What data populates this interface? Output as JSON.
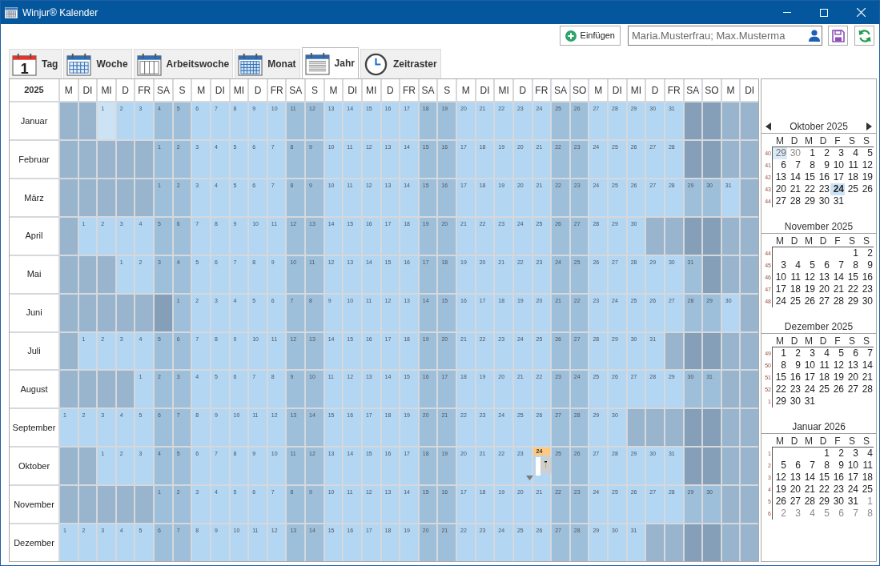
{
  "window": {
    "title": "Winjur® Kalender"
  },
  "toolbar": {
    "insert_button": "Einfügen",
    "people_field": {
      "value": "Maria.Musterfrau; Max.Musterma"
    }
  },
  "tabs": [
    {
      "label": "Tag",
      "kind": "day",
      "icon_text": "1",
      "selected": false
    },
    {
      "label": "Woche",
      "kind": "week",
      "selected": false
    },
    {
      "label": "Arbeitswoche",
      "kind": "workweek",
      "selected": false
    },
    {
      "label": "Monat",
      "kind": "month",
      "selected": false
    },
    {
      "label": "Jahr",
      "kind": "year",
      "selected": true
    },
    {
      "label": "Zeitraster",
      "kind": "timegrid",
      "selected": false
    }
  ],
  "year_grid": {
    "year": "2025",
    "columns": [
      {
        "label": "M",
        "weekend": false
      },
      {
        "label": "DI",
        "weekend": false
      },
      {
        "label": "MI",
        "weekend": false
      },
      {
        "label": "D",
        "weekend": false
      },
      {
        "label": "FR",
        "weekend": false
      },
      {
        "label": "SA",
        "weekend": true
      },
      {
        "label": "S",
        "weekend": true
      },
      {
        "label": "M",
        "weekend": false
      },
      {
        "label": "DI",
        "weekend": false
      },
      {
        "label": "MI",
        "weekend": false
      },
      {
        "label": "D",
        "weekend": false
      },
      {
        "label": "FR",
        "weekend": false
      },
      {
        "label": "SA",
        "weekend": true
      },
      {
        "label": "S",
        "weekend": true
      },
      {
        "label": "M",
        "weekend": false
      },
      {
        "label": "DI",
        "weekend": false
      },
      {
        "label": "MI",
        "weekend": false
      },
      {
        "label": "D",
        "weekend": false
      },
      {
        "label": "FR",
        "weekend": false
      },
      {
        "label": "SA",
        "weekend": true
      },
      {
        "label": "S",
        "weekend": true
      },
      {
        "label": "M",
        "weekend": false
      },
      {
        "label": "DI",
        "weekend": false
      },
      {
        "label": "MI",
        "weekend": false
      },
      {
        "label": "D",
        "weekend": false
      },
      {
        "label": "FR",
        "weekend": false
      },
      {
        "label": "SA",
        "weekend": true
      },
      {
        "label": "SO",
        "weekend": true
      },
      {
        "label": "M",
        "weekend": false
      },
      {
        "label": "DI",
        "weekend": false
      },
      {
        "label": "MI",
        "weekend": false
      },
      {
        "label": "D",
        "weekend": false
      },
      {
        "label": "FR",
        "weekend": false
      },
      {
        "label": "SA",
        "weekend": true
      },
      {
        "label": "SO",
        "weekend": true
      },
      {
        "label": "M",
        "weekend": false
      },
      {
        "label": "DI",
        "weekend": false
      }
    ],
    "months": [
      {
        "name": "Januar",
        "cells": [
          {
            "kind": "blank"
          },
          {
            "kind": "blank"
          },
          {
            "kind": "focus",
            "label": "1"
          },
          "2",
          "3",
          "4",
          "5",
          "6",
          "7",
          "8",
          "9",
          "10",
          "11",
          "12",
          "13",
          "14",
          "15",
          "16",
          "17",
          "18",
          "19",
          "20",
          "21",
          "22",
          "23",
          "24",
          "25",
          "26",
          "27",
          "28",
          "29",
          "30",
          "31",
          {
            "kind": "blank"
          },
          {
            "kind": "blank"
          },
          {
            "kind": "blank"
          },
          {
            "kind": "blank"
          }
        ]
      },
      {
        "name": "Februar",
        "cells": [
          {
            "kind": "blank"
          },
          {
            "kind": "blank"
          },
          {
            "kind": "blank"
          },
          {
            "kind": "blank"
          },
          {
            "kind": "blank"
          },
          "1",
          "2",
          "3",
          "4",
          "5",
          "6",
          "7",
          "8",
          "9",
          "10",
          "11",
          "12",
          "13",
          "14",
          "15",
          "16",
          "17",
          "18",
          "19",
          "20",
          "21",
          "22",
          "23",
          "24",
          "25",
          "26",
          "27",
          "28",
          {
            "kind": "blank"
          },
          {
            "kind": "blank"
          },
          {
            "kind": "blank"
          },
          {
            "kind": "blank"
          }
        ]
      },
      {
        "name": "März",
        "cells": [
          {
            "kind": "blank"
          },
          {
            "kind": "blank"
          },
          {
            "kind": "blank"
          },
          {
            "kind": "blank"
          },
          {
            "kind": "blank"
          },
          "1",
          "2",
          "3",
          "4",
          "5",
          "6",
          "7",
          "8",
          "9",
          "10",
          "11",
          "12",
          "13",
          "14",
          "15",
          "16",
          "17",
          "18",
          "19",
          "20",
          "21",
          "22",
          "23",
          "24",
          "25",
          "26",
          "27",
          "28",
          "29",
          "30",
          "31",
          {
            "kind": "blank"
          }
        ]
      },
      {
        "name": "April",
        "cells": [
          {
            "kind": "blank"
          },
          "1",
          "2",
          "3",
          "4",
          "5",
          "6",
          "7",
          "8",
          "9",
          "10",
          "11",
          "12",
          "13",
          "14",
          "15",
          "16",
          "17",
          "18",
          "19",
          "20",
          "21",
          "22",
          "23",
          "24",
          "25",
          "26",
          "27",
          "28",
          "29",
          "30",
          {
            "kind": "blank"
          },
          {
            "kind": "blank"
          },
          {
            "kind": "blank"
          },
          {
            "kind": "blank"
          },
          {
            "kind": "blank"
          },
          {
            "kind": "blank"
          }
        ]
      },
      {
        "name": "Mai",
        "cells": [
          {
            "kind": "blank"
          },
          {
            "kind": "blank"
          },
          {
            "kind": "blank"
          },
          "1",
          "2",
          "3",
          "4",
          "5",
          "6",
          "7",
          "8",
          "9",
          "10",
          "11",
          "12",
          "13",
          "14",
          "15",
          "16",
          "17",
          "18",
          "19",
          "20",
          "21",
          "22",
          "23",
          "24",
          "25",
          "26",
          "27",
          "28",
          "29",
          "30",
          "31",
          {
            "kind": "blank"
          },
          {
            "kind": "blank"
          },
          {
            "kind": "blank"
          }
        ]
      },
      {
        "name": "Juni",
        "cells": [
          {
            "kind": "blank"
          },
          {
            "kind": "blank"
          },
          {
            "kind": "blank"
          },
          {
            "kind": "blank"
          },
          {
            "kind": "blank"
          },
          {
            "kind": "blank"
          },
          "1",
          "2",
          "3",
          "4",
          "5",
          "6",
          "7",
          "8",
          "9",
          "10",
          "11",
          "12",
          "13",
          "14",
          "15",
          "16",
          "17",
          "18",
          "19",
          "20",
          "21",
          "22",
          "23",
          "24",
          "25",
          "26",
          "27",
          "28",
          "29",
          "30",
          {
            "kind": "blank"
          }
        ]
      },
      {
        "name": "Juli",
        "cells": [
          {
            "kind": "blank"
          },
          "1",
          "2",
          "3",
          "4",
          "5",
          "6",
          "7",
          "8",
          "9",
          "10",
          "11",
          "12",
          "13",
          "14",
          "15",
          "16",
          "17",
          "18",
          "19",
          "20",
          "21",
          "22",
          "23",
          "24",
          "25",
          "26",
          "27",
          "28",
          "29",
          "30",
          "31",
          {
            "kind": "blank"
          },
          {
            "kind": "blank"
          },
          {
            "kind": "blank"
          },
          {
            "kind": "blank"
          },
          {
            "kind": "blank"
          }
        ]
      },
      {
        "name": "August",
        "cells": [
          {
            "kind": "blank"
          },
          {
            "kind": "blank"
          },
          {
            "kind": "blank"
          },
          {
            "kind": "blank"
          },
          "1",
          "2",
          "3",
          "4",
          "5",
          "6",
          "7",
          "8",
          "9",
          "10",
          "11",
          "12",
          "13",
          "14",
          "15",
          "16",
          "17",
          "18",
          "19",
          "20",
          "21",
          "22",
          "23",
          "24",
          "25",
          "26",
          "27",
          "28",
          "29",
          "30",
          "31",
          {
            "kind": "blank"
          },
          {
            "kind": "blank"
          }
        ]
      },
      {
        "name": "September",
        "cells": [
          "1",
          "2",
          "3",
          "4",
          "5",
          "6",
          "7",
          "8",
          "9",
          "10",
          "11",
          "12",
          "13",
          "14",
          "15",
          "16",
          "17",
          "18",
          "19",
          "20",
          "21",
          "22",
          "23",
          "24",
          "25",
          "26",
          "27",
          "28",
          "29",
          "30",
          {
            "kind": "blank"
          },
          {
            "kind": "blank"
          },
          {
            "kind": "blank"
          },
          {
            "kind": "blank"
          },
          {
            "kind": "blank"
          },
          {
            "kind": "blank"
          },
          {
            "kind": "blank"
          }
        ]
      },
      {
        "name": "Oktober",
        "cells": [
          {
            "kind": "blank"
          },
          {
            "kind": "blank"
          },
          "1",
          "2",
          "3",
          "4",
          "5",
          "6",
          "7",
          "8",
          "9",
          "10",
          "11",
          "12",
          "13",
          "14",
          "15",
          "16",
          "17",
          "18",
          "19",
          "20",
          "21",
          "22",
          "23",
          {
            "kind": "today",
            "label": "24",
            "appointment": true
          },
          "25",
          "26",
          "27",
          "28",
          "29",
          "30",
          "31",
          {
            "kind": "blank"
          },
          {
            "kind": "blank"
          },
          {
            "kind": "blank"
          },
          {
            "kind": "blank"
          }
        ]
      },
      {
        "name": "November",
        "cells": [
          {
            "kind": "blank"
          },
          {
            "kind": "blank"
          },
          {
            "kind": "blank"
          },
          {
            "kind": "blank"
          },
          {
            "kind": "blank"
          },
          "1",
          "2",
          "3",
          "4",
          "5",
          "6",
          "7",
          "8",
          "9",
          "10",
          "11",
          "12",
          "13",
          "14",
          "15",
          "16",
          "17",
          "18",
          "19",
          "20",
          "21",
          "22",
          "23",
          "24",
          "25",
          "26",
          "27",
          "28",
          "29",
          "30",
          {
            "kind": "blank"
          },
          {
            "kind": "blank"
          }
        ]
      },
      {
        "name": "Dezember",
        "cells": [
          "1",
          "2",
          "3",
          "4",
          "5",
          "6",
          "7",
          "8",
          "9",
          "10",
          "11",
          "12",
          "13",
          "14",
          "15",
          "16",
          "17",
          "18",
          "19",
          "20",
          "21",
          "22",
          "23",
          "24",
          "25",
          "26",
          "27",
          "28",
          "29",
          "30",
          "31",
          {
            "kind": "blank"
          },
          {
            "kind": "blank"
          },
          {
            "kind": "blank"
          },
          {
            "kind": "blank"
          },
          {
            "kind": "blank"
          },
          {
            "kind": "blank"
          }
        ]
      }
    ]
  },
  "mini_calendars": [
    {
      "title": "Oktober 2025",
      "navigation": true,
      "weekdays": [
        "M",
        "D",
        "M",
        "D",
        "F",
        "S",
        "S"
      ],
      "weeks": [
        {
          "number": "40",
          "days": [
            {
              "kind": "highlighted",
              "label": "29"
            },
            {
              "kind": "adjacent",
              "label": "30"
            },
            "1",
            "2",
            "3",
            "4",
            "5"
          ]
        },
        {
          "number": "41",
          "days": [
            "6",
            "7",
            "8",
            "9",
            "10",
            "11",
            "12"
          ]
        },
        {
          "number": "42",
          "days": [
            "13",
            "14",
            "15",
            "16",
            "17",
            "18",
            "19"
          ]
        },
        {
          "number": "43",
          "days": [
            "20",
            "21",
            "22",
            "23",
            {
              "kind": "selected",
              "label": "24"
            },
            "25",
            "26"
          ]
        },
        {
          "number": "44",
          "days": [
            "27",
            "28",
            "29",
            "30",
            "31"
          ]
        }
      ]
    },
    {
      "title": "November 2025",
      "navigation": false,
      "weekdays": [
        "M",
        "D",
        "M",
        "D",
        "F",
        "S",
        "S"
      ],
      "weeks": [
        {
          "number": "44",
          "days": [
            {
              "kind": "blank"
            },
            {
              "kind": "blank"
            },
            {
              "kind": "blank"
            },
            {
              "kind": "blank"
            },
            {
              "kind": "blank"
            },
            "1",
            "2"
          ]
        },
        {
          "number": "45",
          "days": [
            "3",
            "4",
            "5",
            "6",
            "7",
            "8",
            "9"
          ]
        },
        {
          "number": "46",
          "days": [
            "10",
            "11",
            "12",
            "13",
            "14",
            "15",
            "16"
          ]
        },
        {
          "number": "47",
          "days": [
            "17",
            "18",
            "19",
            "20",
            "21",
            "22",
            "23"
          ]
        },
        {
          "number": "48",
          "days": [
            "24",
            "25",
            "26",
            "27",
            "28",
            "29",
            "30"
          ]
        }
      ]
    },
    {
      "title": "Dezember 2025",
      "navigation": false,
      "weekdays": [
        "M",
        "D",
        "M",
        "D",
        "F",
        "S",
        "S"
      ],
      "weeks": [
        {
          "number": "49",
          "days": [
            "1",
            "2",
            "3",
            "4",
            "5",
            "6",
            "7"
          ]
        },
        {
          "number": "50",
          "days": [
            "8",
            "9",
            "10",
            "11",
            "12",
            "13",
            "14"
          ]
        },
        {
          "number": "51",
          "days": [
            "15",
            "16",
            "17",
            "18",
            "19",
            "20",
            "21"
          ]
        },
        {
          "number": "52",
          "days": [
            "22",
            "23",
            "24",
            "25",
            "26",
            "27",
            "28"
          ]
        },
        {
          "number": "1",
          "days": [
            "29",
            "30",
            "31"
          ]
        }
      ]
    },
    {
      "title": "Januar 2026",
      "navigation": false,
      "weekdays": [
        "M",
        "D",
        "M",
        "D",
        "F",
        "S",
        "S"
      ],
      "weeks": [
        {
          "number": "1",
          "days": [
            {
              "kind": "blank"
            },
            {
              "kind": "blank"
            },
            {
              "kind": "blank"
            },
            "1",
            "2",
            "3",
            "4"
          ]
        },
        {
          "number": "2",
          "days": [
            "5",
            "6",
            "7",
            "8",
            "9",
            "10",
            "11"
          ]
        },
        {
          "number": "3",
          "days": [
            "12",
            "13",
            "14",
            "15",
            "16",
            "17",
            "18"
          ]
        },
        {
          "number": "4",
          "days": [
            "19",
            "20",
            "21",
            "22",
            "23",
            "24",
            "25"
          ]
        },
        {
          "number": "5",
          "days": [
            "26",
            "27",
            "28",
            "29",
            "30",
            "31",
            {
              "kind": "adjacent",
              "label": "1"
            }
          ]
        },
        {
          "number": "6",
          "days": [
            {
              "kind": "adjacent",
              "label": "2"
            },
            {
              "kind": "adjacent",
              "label": "3"
            },
            {
              "kind": "adjacent",
              "label": "4"
            },
            {
              "kind": "adjacent",
              "label": "5"
            },
            {
              "kind": "adjacent",
              "label": "6"
            },
            {
              "kind": "adjacent",
              "label": "7"
            },
            {
              "kind": "adjacent",
              "label": "8"
            }
          ]
        }
      ]
    }
  ]
}
